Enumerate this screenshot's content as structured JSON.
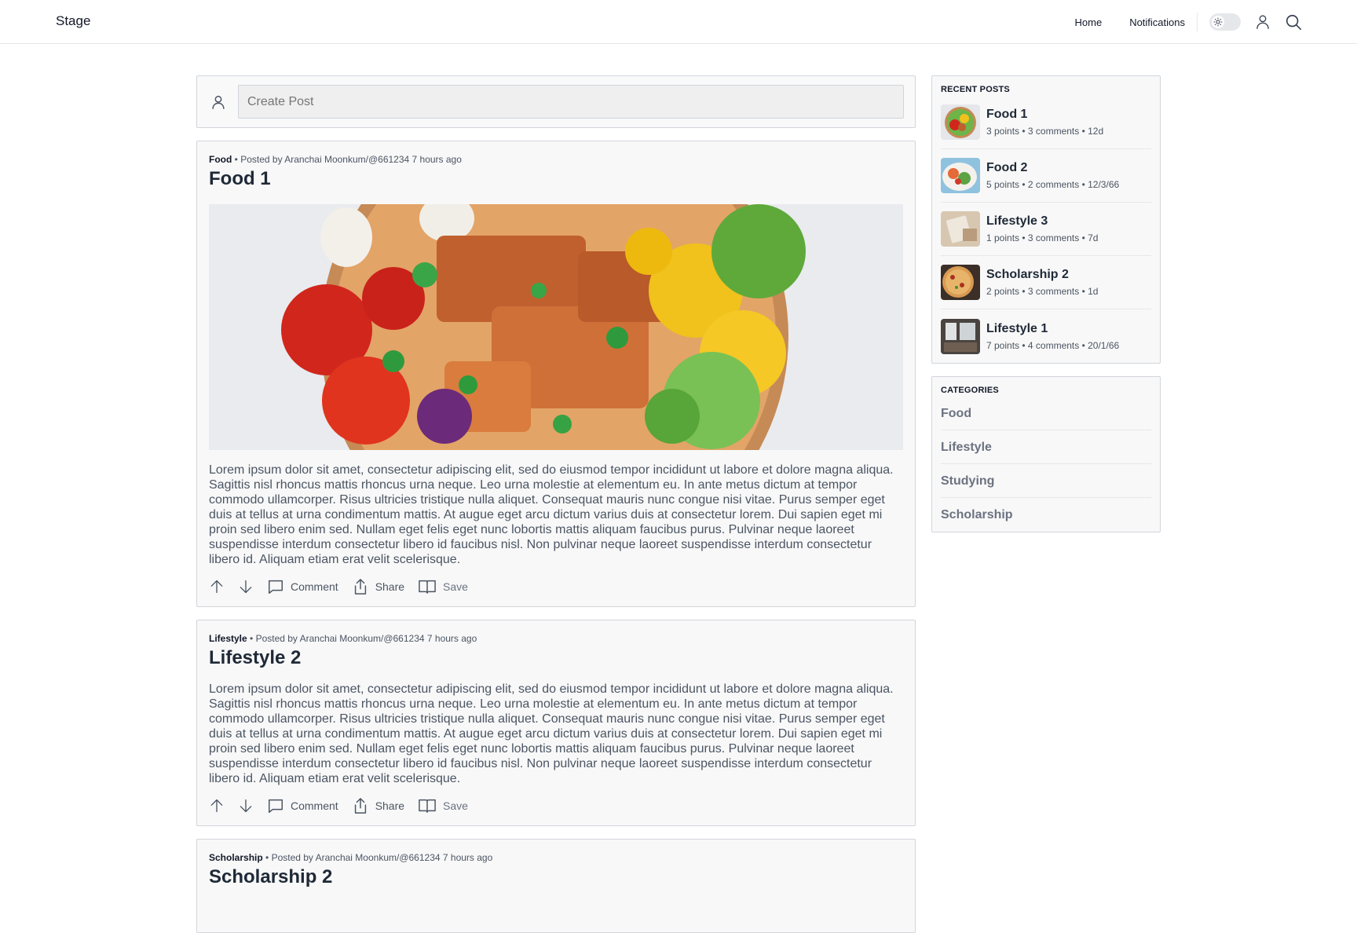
{
  "app": {
    "brand": "Stage"
  },
  "nav": {
    "links": [
      "Home",
      "Notifications"
    ],
    "icons": [
      "sun-icon",
      "user-icon",
      "search-icon"
    ]
  },
  "create_post": {
    "placeholder": "Create Post"
  },
  "posts": [
    {
      "category": "Food",
      "posted_by": "• Posted by Aranchai Moonkum/@661234 7 hours ago",
      "title": "Food 1",
      "has_image": true,
      "body": "Lorem ipsum dolor sit amet, consectetur adipiscing elit, sed do eiusmod tempor incididunt ut labore et dolore magna aliqua. Sagittis nisl rhoncus mattis rhoncus urna neque. Leo urna molestie at elementum eu. In ante metus dictum at tempor commodo ullamcorper. Risus ultricies tristique nulla aliquet. Consequat mauris nunc congue nisi vitae. Purus semper eget duis at tellus at urna condimentum mattis. At augue eget arcu dictum varius duis at consectetur lorem. Dui sapien eget mi proin sed libero enim sed. Nullam eget felis eget nunc lobortis mattis aliquam faucibus purus. Pulvinar neque laoreet suspendisse interdum consectetur libero id faucibus nisl. Non pulvinar neque laoreet suspendisse interdum consectetur libero id. Aliquam etiam erat velit scelerisque."
    },
    {
      "category": "Lifestyle",
      "posted_by": "• Posted by Aranchai Moonkum/@661234 7 hours ago",
      "title": "Lifestyle 2",
      "has_image": false,
      "body": "Lorem ipsum dolor sit amet, consectetur adipiscing elit, sed do eiusmod tempor incididunt ut labore et dolore magna aliqua. Sagittis nisl rhoncus mattis rhoncus urna neque. Leo urna molestie at elementum eu. In ante metus dictum at tempor commodo ullamcorper. Risus ultricies tristique nulla aliquet. Consequat mauris nunc congue nisi vitae. Purus semper eget duis at tellus at urna condimentum mattis. At augue eget arcu dictum varius duis at consectetur lorem. Dui sapien eget mi proin sed libero enim sed. Nullam eget felis eget nunc lobortis mattis aliquam faucibus purus. Pulvinar neque laoreet suspendisse interdum consectetur libero id faucibus nisl. Non pulvinar neque laoreet suspendisse interdum consectetur libero id. Aliquam etiam erat velit scelerisque."
    },
    {
      "category": "Scholarship",
      "posted_by": "• Posted by Aranchai Moonkum/@661234 7 hours ago",
      "title": "Scholarship 2"
    }
  ],
  "post_actions": {
    "comment": "Comment",
    "share": "Share",
    "save": "Save",
    "icons": [
      "arrow-up-icon",
      "arrow-down-icon",
      "comment-icon",
      "share-icon",
      "bookmark-icon"
    ]
  },
  "recent_posts": {
    "heading": "RECENT POSTS",
    "items": [
      {
        "title": "Food 1",
        "stats": "3 points • 3 comments • 12d",
        "thumb": "salad-bowl"
      },
      {
        "title": "Food 2",
        "stats": "5 points • 2 comments • 12/3/66",
        "thumb": "salad-plate"
      },
      {
        "title": "Lifestyle 3",
        "stats": "1 points • 3 comments • 7d",
        "thumb": "desk-photo"
      },
      {
        "title": "Scholarship 2",
        "stats": "2 points • 3 comments • 1d",
        "thumb": "pizza"
      },
      {
        "title": "Lifestyle 1",
        "stats": "7 points • 4 comments • 20/1/66",
        "thumb": "room-photo"
      }
    ]
  },
  "categories": {
    "heading": "CATEGORIES",
    "items": [
      "Food",
      "Lifestyle",
      "Studying",
      "Scholarship"
    ]
  },
  "colors": {
    "border": "#d1d5db",
    "card_bg": "#f8f8f8",
    "text_dark": "#1f2937",
    "text_muted": "#4b5563"
  }
}
